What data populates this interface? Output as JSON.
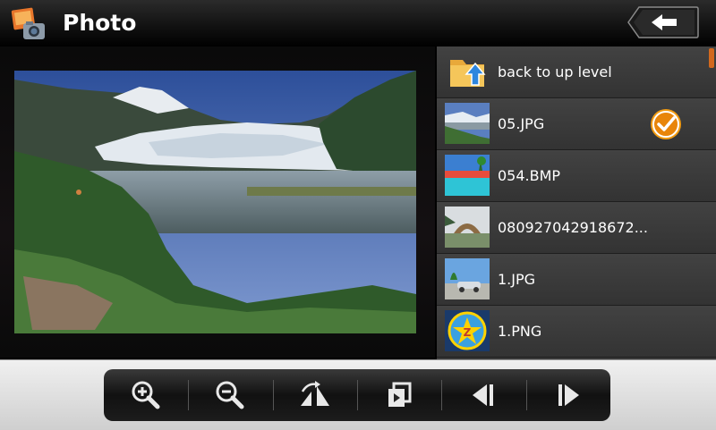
{
  "header": {
    "title": "Photo",
    "app_icon": "photo-app-icon",
    "back_icon": "back-arrow-icon"
  },
  "filelist": {
    "items": [
      {
        "label": "back to up level",
        "icon": "folder-up-icon",
        "selected": false
      },
      {
        "label": "05.JPG",
        "icon": "thumbnail",
        "selected": true
      },
      {
        "label": "054.BMP",
        "icon": "thumbnail",
        "selected": false
      },
      {
        "label": "080927042918672...",
        "icon": "thumbnail",
        "selected": false
      },
      {
        "label": "1.JPG",
        "icon": "thumbnail",
        "selected": false
      },
      {
        "label": "1.PNG",
        "icon": "thumbnail",
        "selected": false
      }
    ]
  },
  "toolbar": {
    "buttons": [
      "zoom-in-icon",
      "zoom-out-icon",
      "rotate-icon",
      "slideshow-icon",
      "previous-icon",
      "next-icon"
    ]
  },
  "colors": {
    "accent": "#f39c12",
    "scrollbar": "#d2691e"
  }
}
